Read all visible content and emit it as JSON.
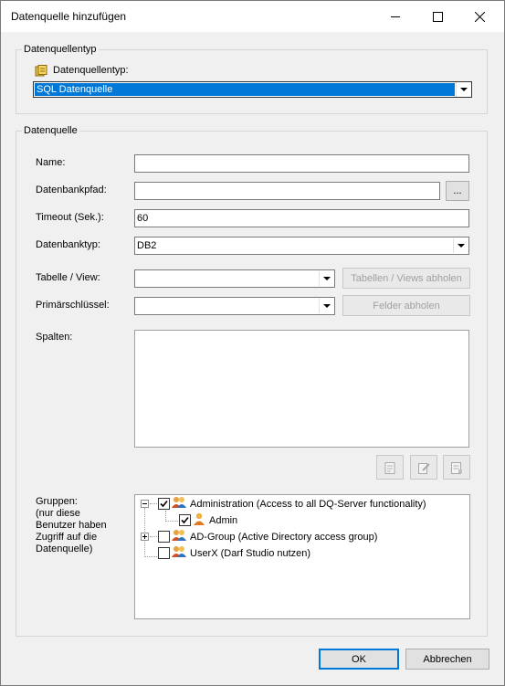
{
  "window": {
    "title": "Datenquelle hinzufügen",
    "minimize_icon": "minimize-icon",
    "maximize_icon": "maximize-icon",
    "close_icon": "close-icon"
  },
  "source_type_group": {
    "legend": "Datenquellentyp",
    "label": "Datenquellentyp:",
    "selected": "SQL Datenquelle"
  },
  "source_group": {
    "legend": "Datenquelle",
    "name_label": "Name:",
    "name_value": "",
    "dbpath_label": "Datenbankpfad:",
    "dbpath_value": "",
    "browse_label": "...",
    "timeout_label": "Timeout (Sek.):",
    "timeout_value": "60",
    "dbtype_label": "Datenbanktyp:",
    "dbtype_value": "DB2",
    "table_label": "Tabelle / View:",
    "table_value": "",
    "fetch_tables_label": "Tabellen / Views abholen",
    "pk_label": "Primärschlüssel:",
    "pk_value": "",
    "fetch_fields_label": "Felder abholen",
    "columns_label": "Spalten:",
    "groups_label": "Gruppen:\n(nur diese\nBenutzer haben\nZugriff auf die\nDatenquelle)"
  },
  "groups_tree": [
    {
      "label": "Administration (Access to all DQ-Server functionality)",
      "checked": true,
      "expanded": true,
      "icon": "group-icon"
    },
    {
      "label": "Admin",
      "checked": true,
      "icon": "user-icon"
    },
    {
      "label": "AD-Group (Active Directory access group)",
      "checked": false,
      "expanded": false,
      "icon": "group-icon"
    },
    {
      "label": "UserX (Darf Studio nutzen)",
      "checked": false,
      "icon": "group-icon"
    }
  ],
  "footer": {
    "ok_label": "OK",
    "cancel_label": "Abbrechen"
  }
}
